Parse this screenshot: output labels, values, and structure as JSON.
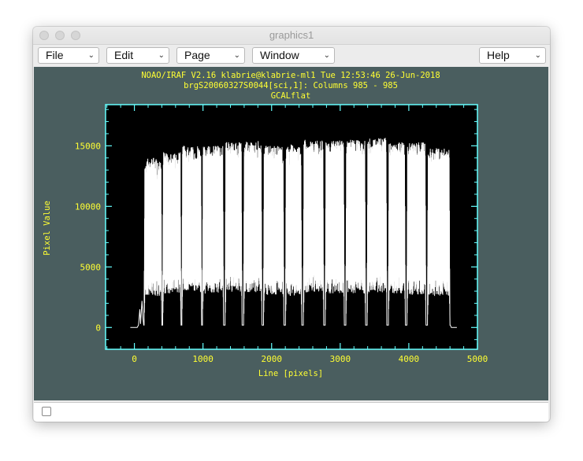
{
  "window": {
    "title": "graphics1"
  },
  "menus": [
    {
      "label": "File"
    },
    {
      "label": "Edit"
    },
    {
      "label": "Page"
    },
    {
      "label": "Window"
    },
    {
      "label": "Help"
    }
  ],
  "plot": {
    "header_line1": "NOAO/IRAF V2.16 klabrie@klabrie-ml1 Tue 12:53:46 26-Jun-2018",
    "header_line2": "brgS20060327S0044[sci,1]: Columns 985 - 985",
    "header_line3": "GCALflat",
    "colors": {
      "background": "#4a5e5f",
      "plot_area": "#000000",
      "frame": "#66ffff",
      "text": "#ffff33",
      "data": "#ffffff"
    }
  },
  "chart_data": {
    "type": "line",
    "xlabel": "Line [pixels]",
    "ylabel": "Pixel Value",
    "xlim": [
      -420,
      5000
    ],
    "ylim": [
      -1800,
      18400
    ],
    "x_ticks": [
      0,
      1000,
      2000,
      3000,
      4000,
      5000
    ],
    "y_ticks": [
      0,
      5000,
      10000,
      15000
    ],
    "x_tick_labels": [
      "0",
      "1000",
      "2000",
      "3000",
      "4000",
      "5000"
    ],
    "y_tick_labels": [
      "0",
      "5000",
      "10000",
      "15000"
    ],
    "series": [
      {
        "slit_blocks": [
          {
            "x_start": 140,
            "x_end": 400,
            "top": 14000,
            "base": 4000
          },
          {
            "x_start": 410,
            "x_end": 680,
            "top": 14500,
            "base": 4200
          },
          {
            "x_start": 690,
            "x_end": 980,
            "top": 15000,
            "base": 4300
          },
          {
            "x_start": 990,
            "x_end": 1300,
            "top": 15000,
            "base": 4200
          },
          {
            "x_start": 1320,
            "x_end": 1570,
            "top": 15300,
            "base": 4300
          },
          {
            "x_start": 1590,
            "x_end": 1860,
            "top": 15400,
            "base": 4300
          },
          {
            "x_start": 1880,
            "x_end": 2180,
            "top": 15000,
            "base": 4100
          },
          {
            "x_start": 2200,
            "x_end": 2440,
            "top": 15100,
            "base": 4000
          },
          {
            "x_start": 2460,
            "x_end": 2760,
            "top": 15500,
            "base": 4300
          },
          {
            "x_start": 2780,
            "x_end": 3060,
            "top": 15500,
            "base": 4200
          },
          {
            "x_start": 3080,
            "x_end": 3370,
            "top": 15500,
            "base": 4200
          },
          {
            "x_start": 3390,
            "x_end": 3680,
            "top": 15700,
            "base": 4300
          },
          {
            "x_start": 3700,
            "x_end": 3950,
            "top": 15300,
            "base": 4200
          },
          {
            "x_start": 3970,
            "x_end": 4250,
            "top": 15300,
            "base": 4100
          },
          {
            "x_start": 4270,
            "x_end": 4600,
            "top": 14800,
            "base": 4000
          }
        ]
      }
    ]
  }
}
